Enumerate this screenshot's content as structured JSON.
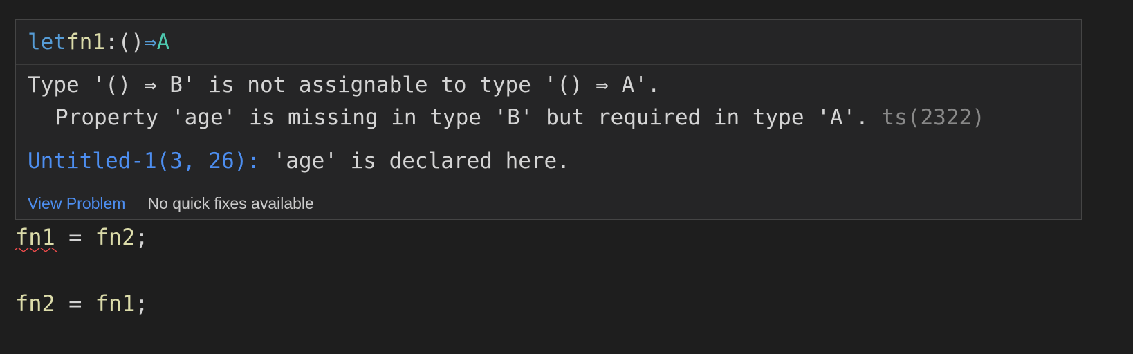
{
  "hover": {
    "signature": {
      "keyword": "let",
      "name": "fn1",
      "colon": ":",
      "params": "()",
      "arrow": "⇒",
      "return_type": "A"
    },
    "message": {
      "line1": "Type '() ⇒ B' is not assignable to type '() ⇒ A'.",
      "line2": "Property 'age' is missing in type 'B' but required in type 'A'.",
      "error_code": "ts(2322)",
      "related_location": "Untitled-1(3, 26):",
      "related_text": "'age' is declared here."
    },
    "status_bar": {
      "view_problem_label": "View Problem",
      "quick_fix_label": "No quick fixes available"
    }
  },
  "editor": {
    "line1": {
      "lhs": "fn1",
      "op": " = ",
      "rhs": "fn2",
      "end": ";"
    },
    "line2": {
      "lhs": "fn2",
      "op": " = ",
      "rhs": "fn1",
      "end": ";"
    }
  },
  "colors": {
    "background": "#1e1e1e",
    "hover_background": "#252526",
    "keyword": "#569cd6",
    "identifier": "#dcdcaa",
    "type": "#4ec9b0",
    "link": "#4d8ef0",
    "error_squiggle": "#f14c4c"
  }
}
